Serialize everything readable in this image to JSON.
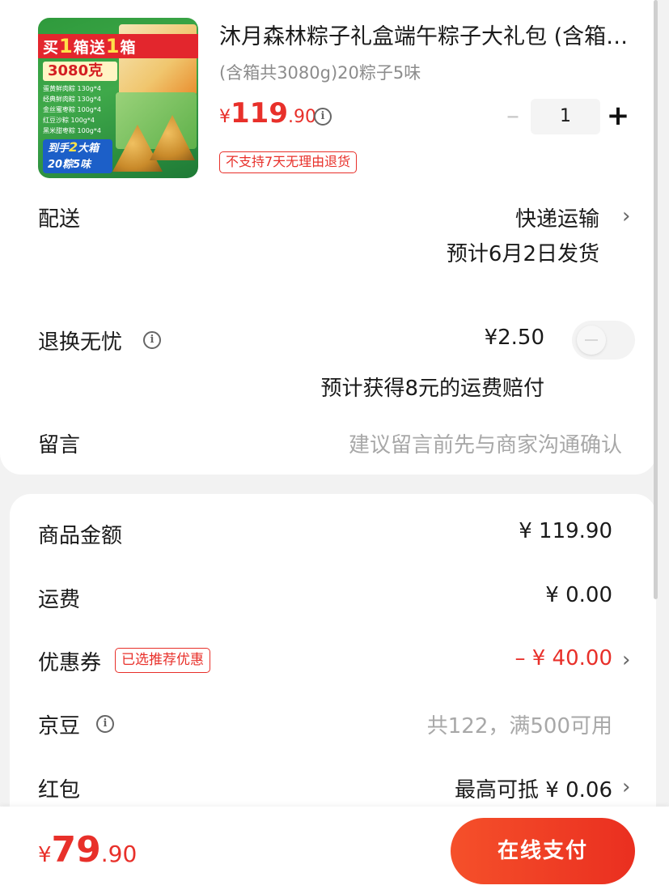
{
  "product": {
    "title": "沐月森林粽子礼盒端午粽子大礼包 (含箱共3080g)20粽子5味",
    "subtitle": "(含箱共3080g)20粽子5味",
    "price": {
      "currency": "¥",
      "integer": "119",
      "decimal": ".90"
    },
    "quantity": "1",
    "return_tag": "不支持7天无理由退货",
    "thumbnail": {
      "banner": [
        "买",
        "1",
        "箱送",
        "1",
        "箱"
      ],
      "weight": "3080克",
      "flavors": [
        "蛋黄鲜肉粽 130g*4",
        "经典鲜肉粽 130g*4",
        "金丝蜜枣粽 100g*4",
        "红豆沙粽 100g*4",
        "黑米甜枣粽 100g*4"
      ],
      "bottom_line1": [
        "到手",
        "2",
        "大箱"
      ],
      "bottom_line2": "20粽5味"
    }
  },
  "delivery": {
    "label": "配送",
    "method": "快递运输",
    "estimate": "预计6月2日发货"
  },
  "return_insurance": {
    "label": "退换无忧",
    "price": "¥2.50",
    "toggle_on": false,
    "note": "预计获得8元的运费赔付"
  },
  "message": {
    "label": "留言",
    "placeholder": "建议留言前先与商家沟通确认"
  },
  "summary": {
    "goods_label": "商品金额",
    "goods_amount": "¥ 119.90",
    "shipping_label": "运费",
    "shipping_amount": "¥ 0.00",
    "coupon_label": "优惠券",
    "coupon_tag": "已选推荐优惠",
    "coupon_amount": "– ¥ 40.00",
    "jingdou_label": "京豆",
    "jingdou_value": "共122，满500可用",
    "redpacket_label": "红包",
    "redpacket_value": "最高可抵 ¥ 0.06"
  },
  "footer": {
    "total": {
      "currency": "¥",
      "integer": "79",
      "decimal": ".90"
    },
    "pay_label": "在线支付"
  },
  "icons": {
    "info": "i",
    "chevron": "›",
    "minus": "–",
    "plus": "+"
  },
  "colors": {
    "accent": "#e8302a",
    "muted": "#a8a8a8"
  }
}
